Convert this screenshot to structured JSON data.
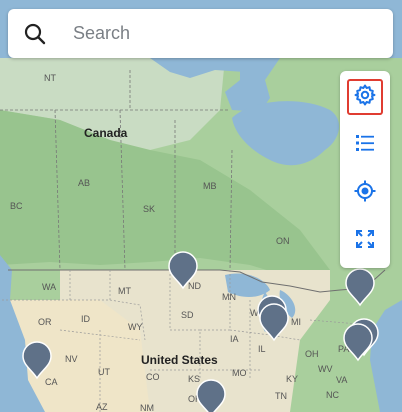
{
  "search": {
    "placeholder": "Search",
    "icon": "search-icon"
  },
  "controls": [
    {
      "name": "settings",
      "icon": "gear-icon",
      "active": true
    },
    {
      "name": "list",
      "icon": "list-icon",
      "active": false
    },
    {
      "name": "locate",
      "icon": "target-icon",
      "active": false
    },
    {
      "name": "fullscreen",
      "icon": "expand-icon",
      "active": false
    }
  ],
  "map": {
    "country_labels": {
      "canada": "Canada",
      "usa": "United States"
    },
    "region_labels": {
      "nt": "NT",
      "ab": "AB",
      "mb": "MB",
      "sk": "SK",
      "bc": "BC",
      "on": "ON",
      "wa": "WA",
      "mt": "MT",
      "nd": "ND",
      "mn": "MN",
      "sd": "SD",
      "wi": "WI",
      "or": "OR",
      "id": "ID",
      "wy": "WY",
      "mi": "MI",
      "ia": "IA",
      "nv": "NV",
      "il": "IL",
      "oh": "OH",
      "pa": "PA",
      "ca": "CA",
      "ut": "UT",
      "co": "CO",
      "ks": "KS",
      "mo": "MO",
      "ky": "KY",
      "wv": "WV",
      "va": "VA",
      "az": "AZ",
      "nm": "NM",
      "ok": "OK",
      "tn": "TN",
      "nc": "NC"
    },
    "colors": {
      "water": "#8fb7d6",
      "forest": "#a9cf9d",
      "tundra": "#c8dcc0",
      "plains": "#e9e4cf",
      "desert": "#efe4c6",
      "marker": "#5f7188"
    }
  }
}
